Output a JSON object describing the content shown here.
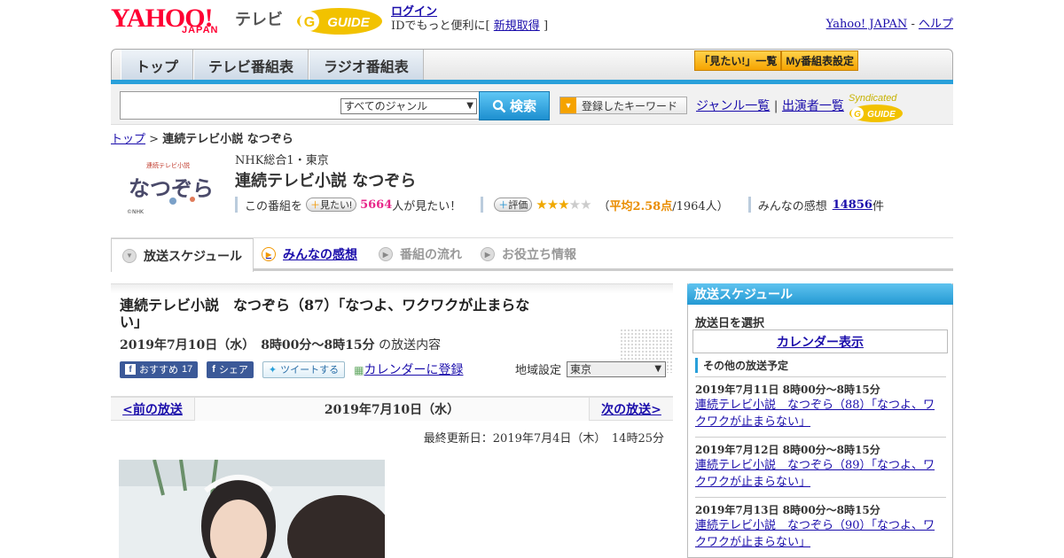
{
  "header": {
    "yahoo_logo": "YAHOO!",
    "yahoo_sub": "JAPAN",
    "tv_label": "テレビ",
    "gguide_logo": "GUIDE",
    "login": "ログイン",
    "login_note": "IDでもっと便利に[",
    "signup": "新規取得",
    "login_note_end": "]",
    "yahoo_japan_link": "Yahoo! JAPAN",
    "separator": "-",
    "help_link": "ヘルプ"
  },
  "nav": {
    "tabs": [
      "トップ",
      "テレビ番組表",
      "ラジオ番組表"
    ],
    "mitai_list": "「見たい!」一覧",
    "my_schedule": "My番組表設定"
  },
  "search": {
    "genre": "すべてのジャンル",
    "button": "検索",
    "keywords_button": "登録したキーワード",
    "genre_list": "ジャンル一覧",
    "divider": "|",
    "performer_list": "出演者一覧",
    "syndicated": "Syndicated"
  },
  "breadcrumb": {
    "top": "トップ",
    "sep": ">",
    "current": "連続テレビ小説 なつぞら"
  },
  "program": {
    "channel": "NHK総合1・東京",
    "title": "連続テレビ小説 なつぞら",
    "logo_text": "なつぞら",
    "logo_sub": "連続テレビ小説",
    "logo_credit": "©NHK",
    "want_prefix": "この番組を",
    "want_button": "見たい!",
    "want_count": "5664",
    "want_suffix": "人が見たい！",
    "rating_button": "評価",
    "rating_open": "（",
    "rating_avg": "平均2.58点",
    "rating_people": "/1964人）",
    "rating_value": 2.58,
    "impressions_label": "みんなの感想",
    "impressions_count": "14856",
    "impressions_suffix": "件"
  },
  "tabs": [
    {
      "label": "放送スケジュール",
      "state": "active"
    },
    {
      "label": "みんなの感想",
      "state": "link"
    },
    {
      "label": "番組の流れ",
      "state": "disabled"
    },
    {
      "label": "お役立ち情報",
      "state": "disabled"
    }
  ],
  "episode": {
    "title": "連続テレビ小説　なつぞら（87）「なつよ、ワクワクが止まらない」",
    "date_time": "2019年7月10日（水）　8時00分～8時15分",
    "date_suffix": "の放送内容",
    "recommend": "おすすめ",
    "recommend_count": "17",
    "share": "シェア",
    "tweet": "ツイートする",
    "calendar": "カレンダーに登録",
    "region_label": "地域設定",
    "region_value": "東京",
    "prev": "<前の放送",
    "current_date": "2019年7月10日（水）",
    "next": "次の放送>",
    "updated": "最終更新日：2019年7月4日（木）　14時25分"
  },
  "sidebar": {
    "header": "放送スケジュール",
    "select_date": "放送日を選択",
    "calendar_button": "カレンダー表示",
    "other_header": "その他の放送予定",
    "items": [
      {
        "date": "2019年7月11日  8時00分～8時15分",
        "title": "連続テレビ小説　なつぞら（88）「なつよ、ワクワクが止まらない」"
      },
      {
        "date": "2019年7月12日  8時00分～8時15分",
        "title": "連続テレビ小説　なつぞら（89）「なつよ、ワクワクが止まらない」"
      },
      {
        "date": "2019年7月13日  8時00分～8時15分",
        "title": "連続テレビ小説　なつぞら（90）「なつよ、ワクワクが止まらない」"
      }
    ]
  },
  "colors": {
    "accent_blue": "#29a0da",
    "brand_red": "#ff0033",
    "orange": "#f5a300",
    "pink": "#e8278a"
  }
}
